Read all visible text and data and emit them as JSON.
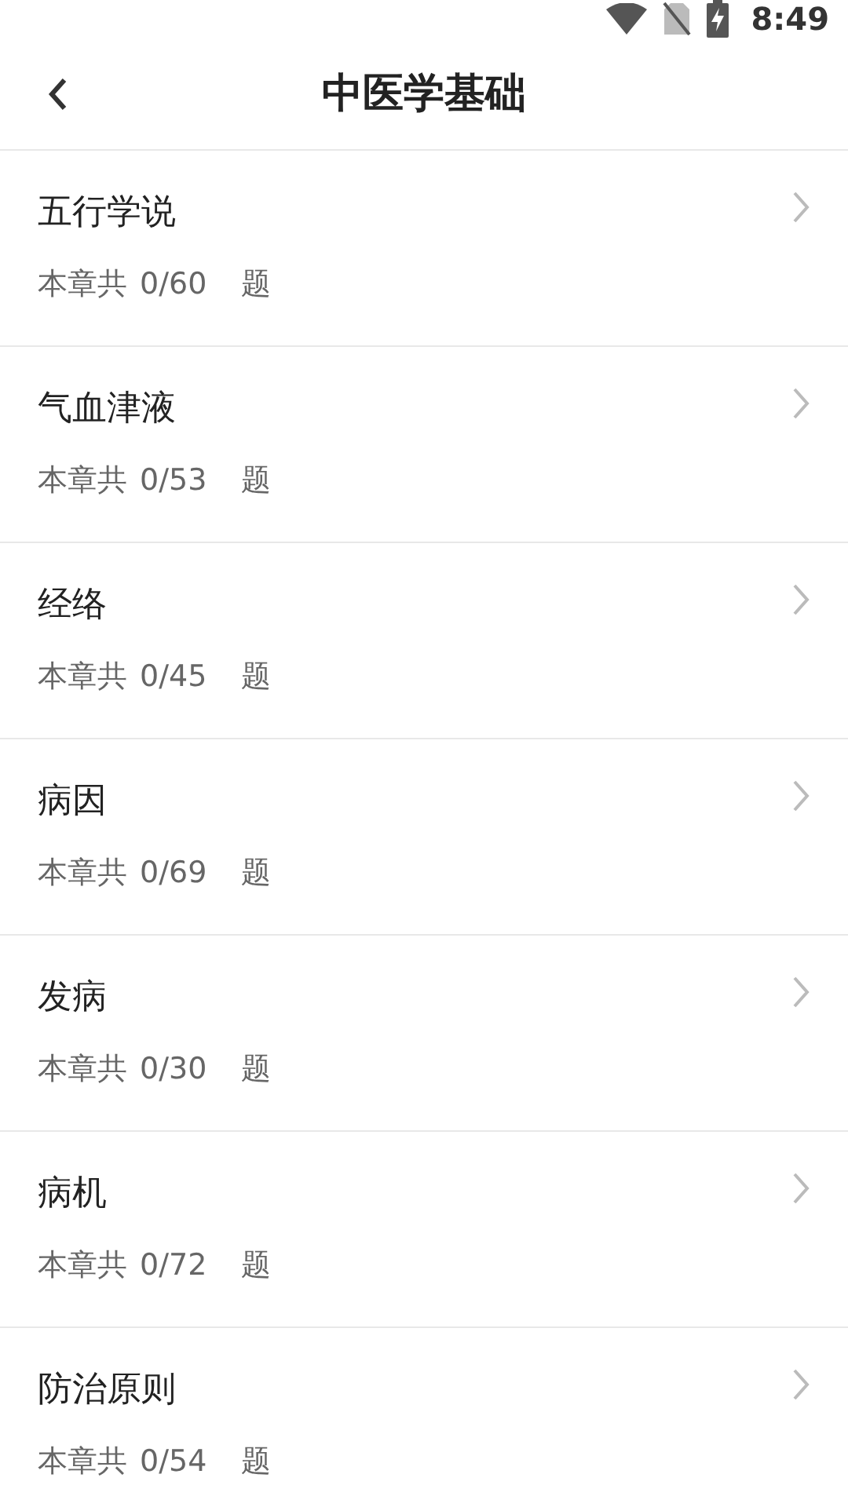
{
  "status_bar": {
    "time": "8:49"
  },
  "header": {
    "title": "中医学基础"
  },
  "chapters": [
    {
      "title": "五行学说",
      "prefix": "本章共",
      "count": "0/60",
      "suffix": "题"
    },
    {
      "title": "气血津液",
      "prefix": "本章共",
      "count": "0/53",
      "suffix": "题"
    },
    {
      "title": "经络",
      "prefix": "本章共",
      "count": "0/45",
      "suffix": "题"
    },
    {
      "title": "病因",
      "prefix": "本章共",
      "count": "0/69",
      "suffix": "题"
    },
    {
      "title": "发病",
      "prefix": "本章共",
      "count": "0/30",
      "suffix": "题"
    },
    {
      "title": "病机",
      "prefix": "本章共",
      "count": "0/72",
      "suffix": "题"
    },
    {
      "title": "防治原则",
      "prefix": "本章共",
      "count": "0/54",
      "suffix": "题"
    }
  ]
}
